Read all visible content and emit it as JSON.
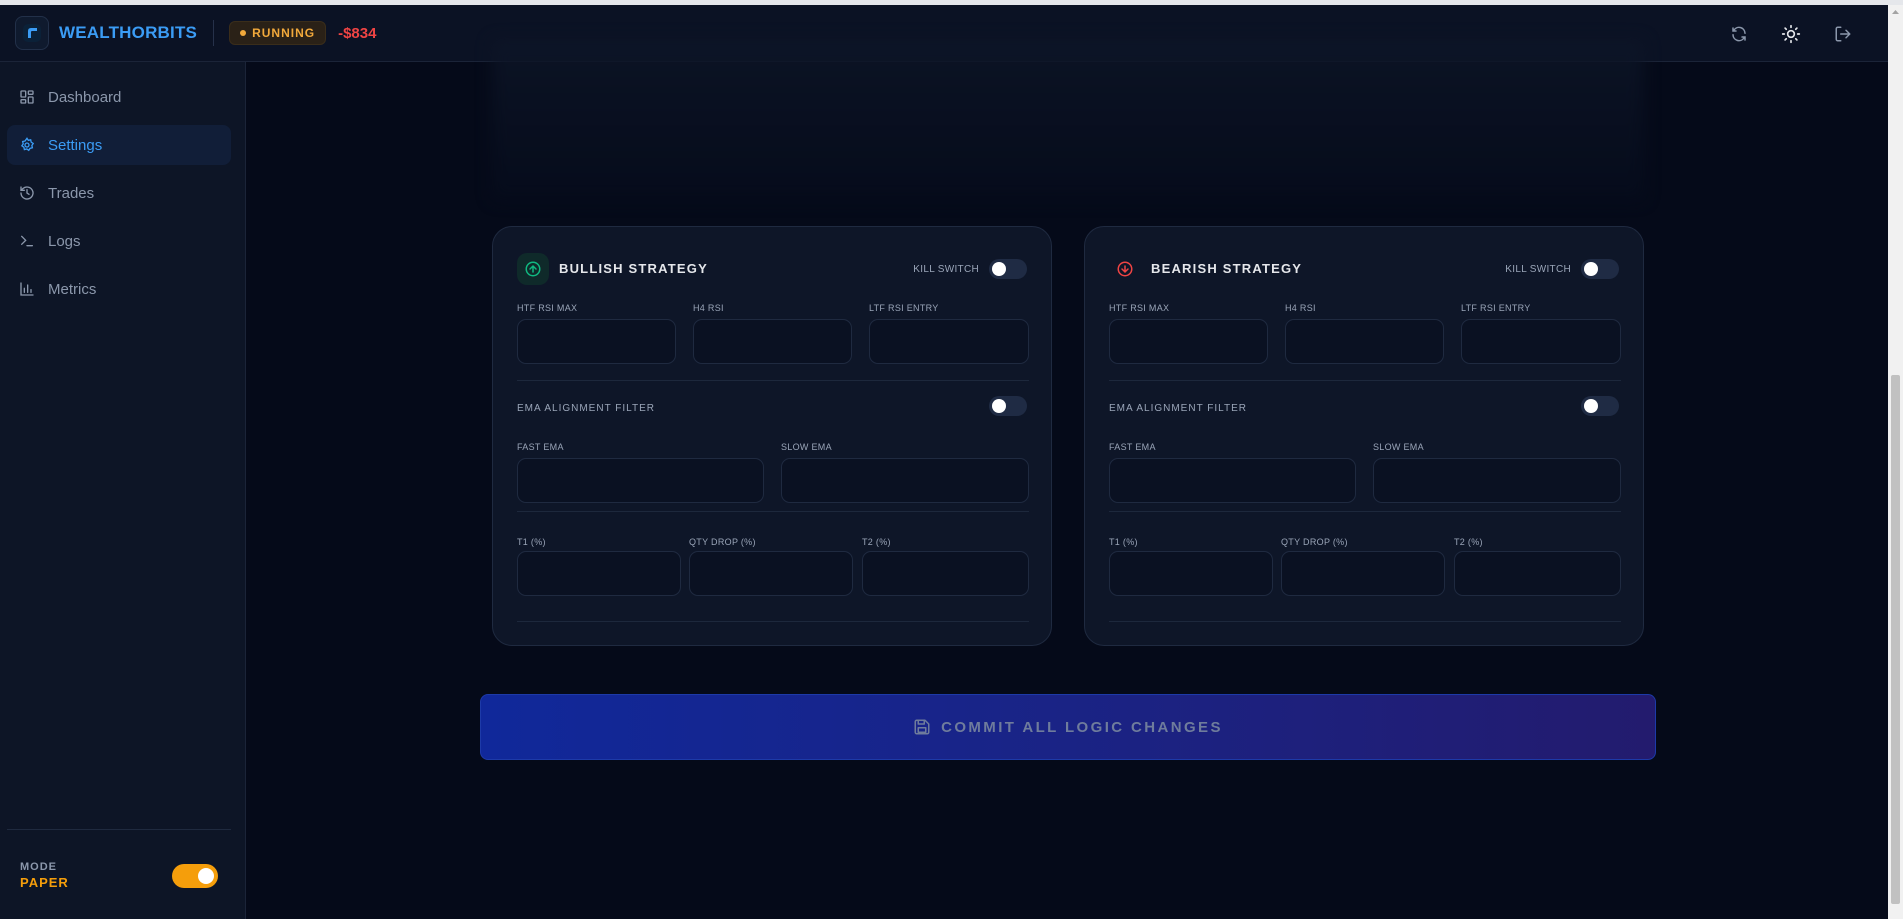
{
  "header": {
    "brand": "WEALTHORBITS",
    "status": "RUNNING",
    "pnl": "-$834",
    "icons": [
      "refresh-icon",
      "sun-icon",
      "logout-icon"
    ]
  },
  "sidebar": {
    "items": [
      {
        "label": "Dashboard",
        "icon": "grid-icon",
        "active": false
      },
      {
        "label": "Settings",
        "icon": "gear-icon",
        "active": true
      },
      {
        "label": "Trades",
        "icon": "history-icon",
        "active": false
      },
      {
        "label": "Logs",
        "icon": "terminal-icon",
        "active": false
      },
      {
        "label": "Metrics",
        "icon": "bar-chart-icon",
        "active": false
      }
    ],
    "mode_label": "MODE",
    "mode_value": "PAPER",
    "mode_toggle_on": true
  },
  "bullish": {
    "title": "BULLISH STRATEGY",
    "kill_switch_label": "KILL SWITCH",
    "kill_switch_on": false,
    "htf_rsi_max": "HTF RSI MAX",
    "h4_rsi": "H4 RSI",
    "ltf_rsi_entry": "LTF RSI ENTRY",
    "ema_filter_label": "EMA ALIGNMENT FILTER",
    "ema_filter_on": false,
    "fast_ema": "FAST EMA",
    "slow_ema": "SLOW EMA",
    "t1": "T1 (%)",
    "qty_drop": "QTY DROP (%)",
    "t2": "T2 (%)"
  },
  "bearish": {
    "title": "BEARISH STRATEGY",
    "kill_switch_label": "KILL SWITCH",
    "kill_switch_on": false,
    "htf_rsi_max": "HTF RSI MAX",
    "h4_rsi": "H4 RSI",
    "ltf_rsi_entry": "LTF RSI ENTRY",
    "ema_filter_label": "EMA ALIGNMENT FILTER",
    "ema_filter_on": false,
    "fast_ema": "FAST EMA",
    "slow_ema": "SLOW EMA",
    "t1": "T1 (%)",
    "qty_drop": "QTY DROP (%)",
    "t2": "T2 (%)"
  },
  "commit_label": "COMMIT ALL LOGIC CHANGES",
  "colors": {
    "accent": "#3b9cf5",
    "bullish": "#10b981",
    "bearish": "#ef4444",
    "warning": "#f59e0b",
    "background": "#050a19"
  }
}
